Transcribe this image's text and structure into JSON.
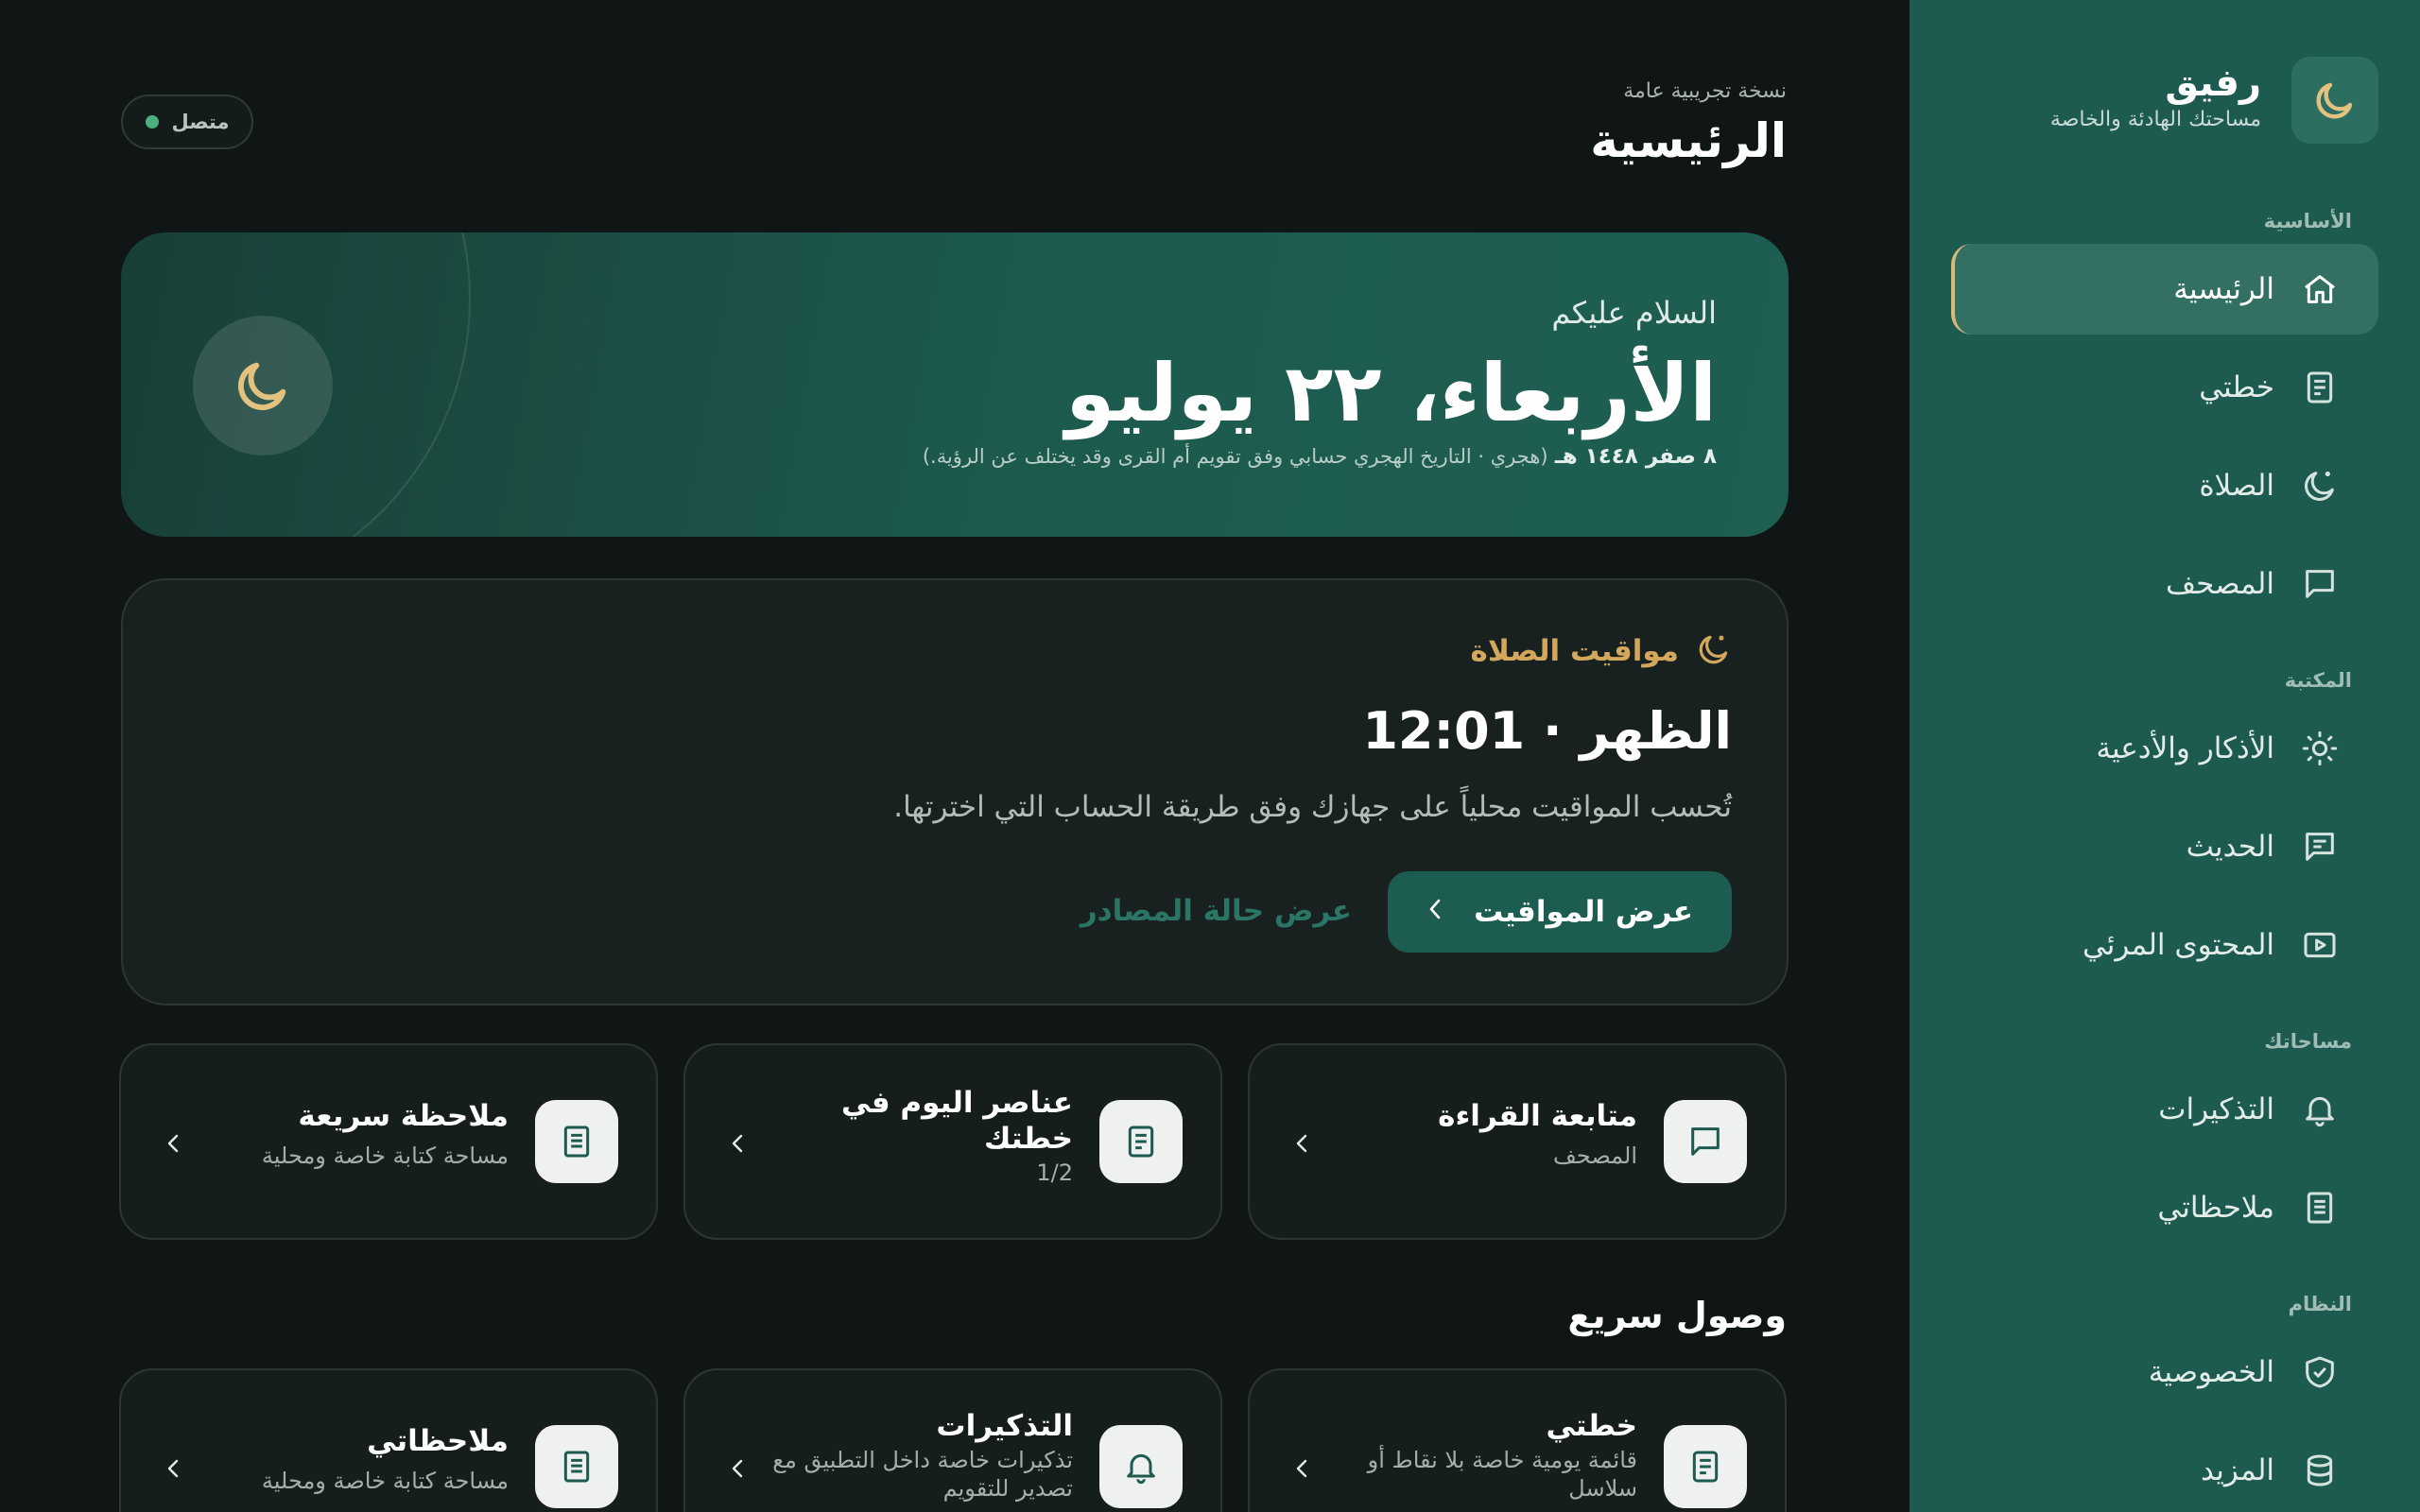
{
  "brand": {
    "name": "رفيق",
    "subtitle": "مساحتك الهادئة والخاصة",
    "icon": "moon-icon"
  },
  "sidebar": {
    "sections": {
      "core": "الأساسية",
      "library": "المكتبة",
      "spaces": "مساحاتك",
      "system": "النظام"
    },
    "items": [
      {
        "label": "الرئيسية",
        "icon": "home-icon",
        "active": true
      },
      {
        "label": "خطتي",
        "icon": "plan-icon"
      },
      {
        "label": "الصلاة",
        "icon": "crescent-icon"
      },
      {
        "label": "المصحف",
        "icon": "message-square-icon"
      },
      {
        "label": "الأذكار والأدعية",
        "icon": "sun-icon"
      },
      {
        "label": "الحديث",
        "icon": "message-text-icon"
      },
      {
        "label": "المحتوى المرئي",
        "icon": "video-icon"
      },
      {
        "label": "التذكيرات",
        "icon": "bell-icon"
      },
      {
        "label": "ملاحظاتي",
        "icon": "note-icon"
      },
      {
        "label": "الخصوصية",
        "icon": "shield-check-icon"
      },
      {
        "label": "المزيد",
        "icon": "database-icon"
      }
    ]
  },
  "header": {
    "kicker": "نسخة تجريبية عامة",
    "title": "الرئيسية"
  },
  "status": {
    "label": "متصل",
    "color": "#4caf7d"
  },
  "hero": {
    "greeting": "السلام عليكم",
    "date": "الأربعاء، ٢٢ يوليو",
    "hijri": "٨ صفر ١٤٤٨ هـ",
    "hijri_note": "(هجري · التاريخ الهجري حسابي وفق تقويم أم القرى وقد يختلف عن الرؤية.)"
  },
  "prayer": {
    "heading": "مواقيت الصلاة",
    "current": "الظهر · 12:01",
    "note": "تُحسب المواقيت محلياً على جهازك وفق طريقة الحساب التي اخترتها.",
    "primary_button": "عرض المواقيت",
    "secondary_link": "عرض حالة المصادر"
  },
  "tiles": [
    {
      "title": "متابعة القراءة",
      "subtitle": "المصحف",
      "icon": "message-square-icon"
    },
    {
      "title": "عناصر اليوم في خطتك",
      "subtitle": "1/2",
      "icon": "plan-icon"
    },
    {
      "title": "ملاحظة سريعة",
      "subtitle": "مساحة كتابة خاصة ومحلية",
      "icon": "note-icon"
    }
  ],
  "quick_access": {
    "title": "وصول سريع",
    "tiles": [
      {
        "title": "خطتي",
        "subtitle": "قائمة يومية خاصة بلا نقاط أو سلاسل",
        "icon": "plan-icon"
      },
      {
        "title": "التذكيرات",
        "subtitle": "تذكيرات خاصة داخل التطبيق مع تصدير للتقويم",
        "icon": "bell-icon"
      },
      {
        "title": "ملاحظاتي",
        "subtitle": "مساحة كتابة خاصة ومحلية",
        "icon": "note-icon"
      }
    ]
  },
  "colors": {
    "sidebar": "#1d5a4f",
    "background": "#0f1615",
    "accent_gold": "#d4a85c",
    "primary_button": "#1d5c50",
    "link": "#2a7566"
  }
}
